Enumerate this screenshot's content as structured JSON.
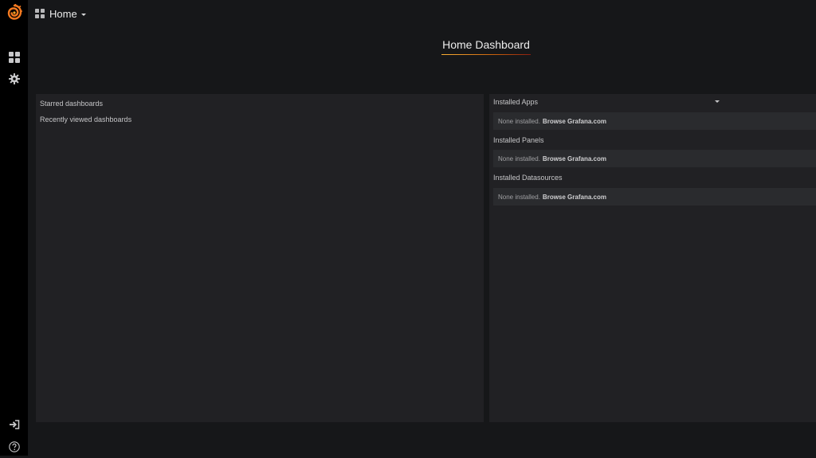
{
  "navbar": {
    "title": "Home"
  },
  "dashboard": {
    "title": "Home Dashboard"
  },
  "dashlist": {
    "starred_label": "Starred dashboards",
    "recent_label": "Recently viewed dashboards"
  },
  "plugins": {
    "apps_title": "Installed Apps",
    "panels_title": "Installed Panels",
    "datasources_title": "Installed Datasources",
    "none_installed_text": "None installed.",
    "browse_link": "Browse Grafana.com"
  },
  "colors": {
    "sidemenu_bg": "#000000",
    "page_bg": "#161719",
    "panel_bg": "#212124",
    "plugin_box_bg": "#2a2b2e",
    "logo_orange": "#f47a20",
    "header_underline": "#fbb034"
  },
  "icons": {
    "logo": "grafana-logo-icon",
    "dashboards": "dashboards-icon",
    "config": "gear-icon",
    "sign_in": "sign-in-icon",
    "help": "help-icon",
    "nav_dashboard": "dashboard-grid-icon"
  }
}
